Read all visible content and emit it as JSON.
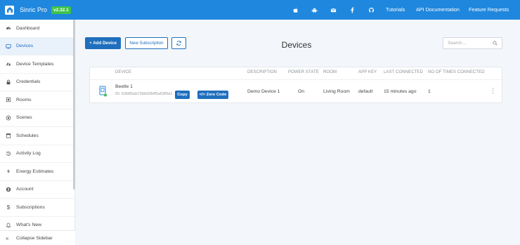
{
  "app": {
    "name": "Sinric Pro",
    "version": "v2.32.1"
  },
  "topnav": {
    "icons": [
      "apple-icon",
      "android-icon",
      "mail-icon",
      "facebook-icon",
      "github-icon"
    ],
    "links": [
      "Tutorials",
      "API Documentation",
      "Feature Requests"
    ]
  },
  "sidebar": {
    "items": [
      {
        "label": "Dashboard",
        "icon": "dashboard-icon"
      },
      {
        "label": "Devices",
        "icon": "devices-icon",
        "active": true
      },
      {
        "label": "Device Templates",
        "icon": "templates-icon"
      },
      {
        "label": "Credentials",
        "icon": "lock-icon"
      },
      {
        "label": "Rooms",
        "icon": "rooms-icon"
      },
      {
        "label": "Scenes",
        "icon": "scenes-icon"
      },
      {
        "label": "Schedules",
        "icon": "calendar-icon"
      },
      {
        "label": "Activity Log",
        "icon": "history-icon"
      },
      {
        "label": "Energy Estimates",
        "icon": "bolt-icon"
      },
      {
        "label": "Account",
        "icon": "user-icon"
      },
      {
        "label": "Subscriptions",
        "icon": "dollar-icon"
      },
      {
        "label": "What's New",
        "icon": "bell-icon"
      }
    ],
    "collapse_label": "Collapse Sidebar"
  },
  "toolbar": {
    "add_device": "+ Add Device",
    "new_subscription": "New Subscription",
    "refresh_icon": "refresh-icon"
  },
  "page": {
    "title": "Devices"
  },
  "search": {
    "placeholder": "Search...",
    "value": ""
  },
  "table": {
    "columns": [
      "Device",
      "Description",
      "Power State",
      "Room",
      "App Key",
      "Last Connected",
      "No of times connected"
    ],
    "rows": [
      {
        "name": "Beetle 1",
        "id": "ID: 63b85ab72bb02bff3a63f9a1",
        "copy_label": "Copy",
        "zero_code_label": "</> Zero Code",
        "description": "Demo Device 1",
        "power_state": "On",
        "room": "Living Room",
        "app_key": "default",
        "last_connected": "15 minutes ago",
        "times_connected": "1",
        "online": true
      }
    ]
  },
  "colors": {
    "topbar": "#1f87dd",
    "primary": "#1f6fbe",
    "version_badge": "#3fc24c",
    "online": "#3fc24c"
  }
}
